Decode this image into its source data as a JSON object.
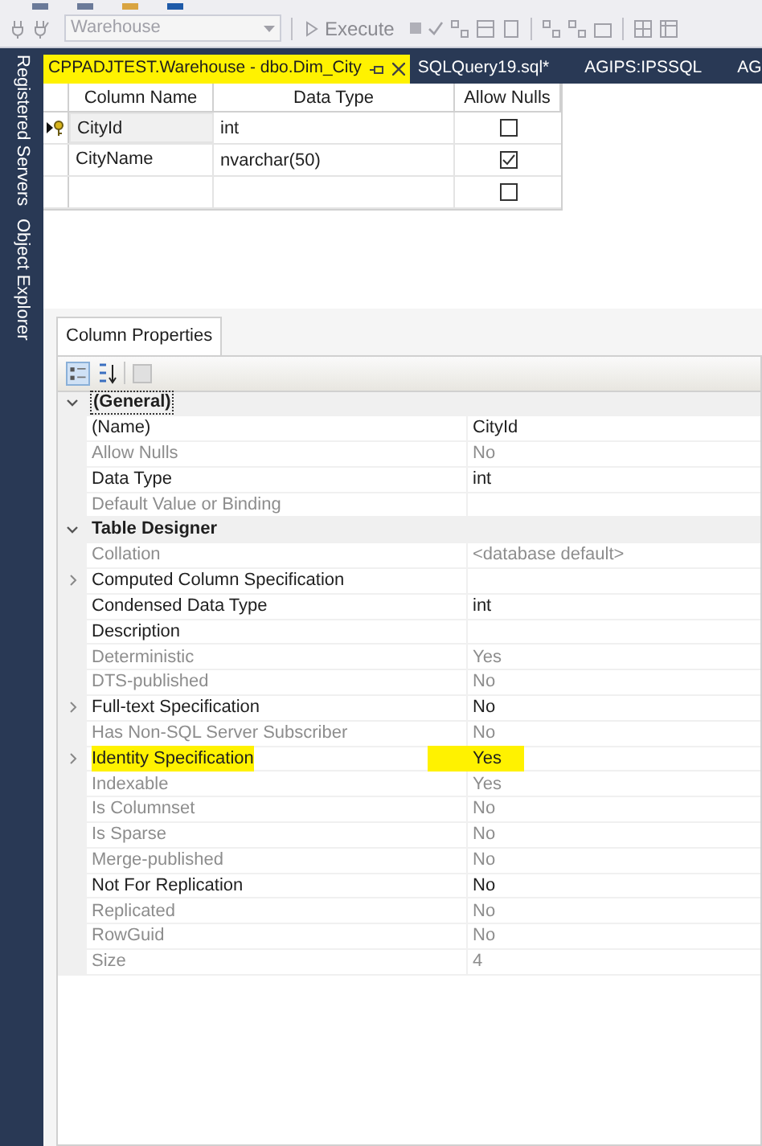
{
  "toolbar": {
    "database": {
      "value": "Warehouse",
      "disabled": true
    },
    "execute": {
      "label": "Execute",
      "disabled": true
    }
  },
  "sidebar": {
    "items": [
      "Registered Servers",
      "Object Explorer"
    ]
  },
  "tabs": [
    {
      "label": "CPPADJTEST.Warehouse - dbo.Dim_City",
      "selected": true
    },
    {
      "label": "SQLQuery19.sql*",
      "selected": false
    },
    {
      "label": "AGIPS:IPSSQL",
      "selected": false
    },
    {
      "label": "AG",
      "selected": false
    }
  ],
  "table": {
    "columns": [
      "Column Name",
      "Data Type",
      "Allow Nulls"
    ],
    "rows": [
      {
        "column_name": "CityId",
        "data_type": "int",
        "allow_nulls": false,
        "primary_key": true,
        "selected": true
      },
      {
        "column_name": "CityName",
        "data_type": "nvarchar(50)",
        "allow_nulls": true,
        "primary_key": false,
        "selected": false
      },
      {
        "allow_nulls": false,
        "primary_key": false,
        "selected": false
      }
    ]
  },
  "column_properties": {
    "title": "Column Properties",
    "rows": [
      {
        "kind": "category",
        "name": "(General)",
        "expanded": true,
        "selected": true
      },
      {
        "kind": "property",
        "name": "(Name)",
        "value": "CityId",
        "disabled": false,
        "expandable": false,
        "highlighted": false
      },
      {
        "kind": "property",
        "name": "Allow Nulls",
        "value": "No",
        "disabled": true,
        "expandable": false,
        "highlighted": false
      },
      {
        "kind": "property",
        "name": "Data Type",
        "value": "int",
        "disabled": false,
        "expandable": false,
        "highlighted": false
      },
      {
        "kind": "property",
        "name": "Default Value or Binding",
        "disabled": true,
        "expandable": false,
        "highlighted": false
      },
      {
        "kind": "category",
        "name": "Table Designer",
        "expanded": true,
        "selected": false
      },
      {
        "kind": "property",
        "name": "Collation",
        "value": "<database default>",
        "disabled": true,
        "expandable": false,
        "highlighted": false
      },
      {
        "kind": "property",
        "name": "Computed Column Specification",
        "disabled": false,
        "expandable": true,
        "highlighted": false
      },
      {
        "kind": "property",
        "name": "Condensed Data Type",
        "value": "int",
        "disabled": false,
        "expandable": false,
        "highlighted": false
      },
      {
        "kind": "property",
        "name": "Description",
        "disabled": false,
        "expandable": false,
        "highlighted": false
      },
      {
        "kind": "property",
        "name": "Deterministic",
        "value": "Yes",
        "disabled": true,
        "expandable": false,
        "highlighted": false
      },
      {
        "kind": "property",
        "name": "DTS-published",
        "value": "No",
        "disabled": true,
        "expandable": false,
        "highlighted": false
      },
      {
        "kind": "property",
        "name": "Full-text Specification",
        "value": "No",
        "disabled": false,
        "expandable": true,
        "highlighted": false
      },
      {
        "kind": "property",
        "name": "Has Non-SQL Server Subscriber",
        "value": "No",
        "disabled": true,
        "expandable": false,
        "highlighted": false
      },
      {
        "kind": "property",
        "name": "Identity Specification",
        "value": "Yes",
        "disabled": false,
        "expandable": true,
        "highlighted": true
      },
      {
        "kind": "property",
        "name": "Indexable",
        "value": "Yes",
        "disabled": true,
        "expandable": false,
        "highlighted": false
      },
      {
        "kind": "property",
        "name": "Is Columnset",
        "value": "No",
        "disabled": true,
        "expandable": false,
        "highlighted": false
      },
      {
        "kind": "property",
        "name": "Is Sparse",
        "value": "No",
        "disabled": true,
        "expandable": false,
        "highlighted": false
      },
      {
        "kind": "property",
        "name": "Merge-published",
        "value": "No",
        "disabled": true,
        "expandable": false,
        "highlighted": false
      },
      {
        "kind": "property",
        "name": "Not For Replication",
        "value": "No",
        "disabled": false,
        "expandable": false,
        "highlighted": false
      },
      {
        "kind": "property",
        "name": "Replicated",
        "value": "No",
        "disabled": true,
        "expandable": false,
        "highlighted": false
      },
      {
        "kind": "property",
        "name": "RowGuid",
        "value": "No",
        "disabled": true,
        "expandable": false,
        "highlighted": false
      },
      {
        "kind": "property",
        "name": "Size",
        "value": "4",
        "disabled": true,
        "expandable": false,
        "highlighted": false
      }
    ]
  }
}
